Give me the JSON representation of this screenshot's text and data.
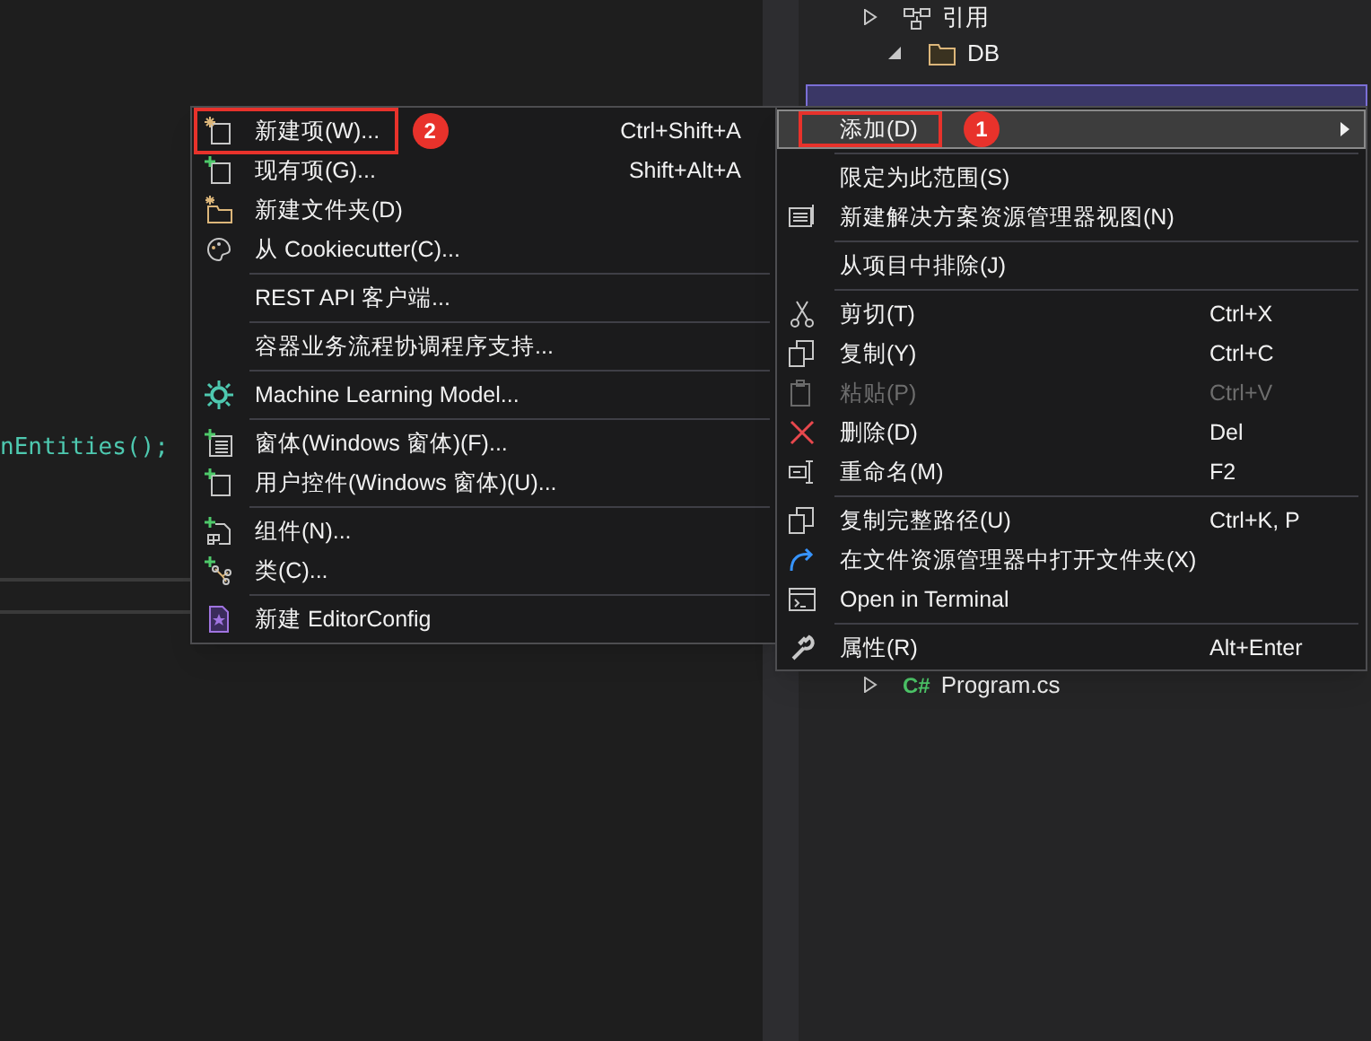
{
  "editor": {
    "code_line": "nEntities();"
  },
  "solution_explorer": {
    "items": [
      {
        "label": "引用",
        "kind": "references",
        "expanded": false
      },
      {
        "label": "DB",
        "kind": "folder",
        "expanded": true
      },
      {
        "label": "Program.cs",
        "kind": "csharp",
        "icon_text": "C#",
        "expanded": false
      }
    ]
  },
  "context_menu": {
    "items": [
      {
        "kind": "item",
        "label": "添加(D)",
        "disabled": false,
        "selected": true,
        "submenu": true,
        "annotation": "1"
      },
      {
        "kind": "separator"
      },
      {
        "kind": "item",
        "label": "限定为此范围(S)",
        "disabled": false,
        "selected": false,
        "submenu": false
      },
      {
        "kind": "item",
        "label": "新建解决方案资源管理器视图(N)",
        "disabled": false,
        "selected": false,
        "submenu": false
      },
      {
        "kind": "separator"
      },
      {
        "kind": "item",
        "label": "从项目中排除(J)",
        "disabled": false,
        "selected": false,
        "submenu": false
      },
      {
        "kind": "separator"
      },
      {
        "kind": "item",
        "label": "剪切(T)",
        "shortcut": "Ctrl+X",
        "disabled": false,
        "selected": false,
        "submenu": false
      },
      {
        "kind": "item",
        "label": "复制(Y)",
        "shortcut": "Ctrl+C",
        "disabled": false,
        "selected": false,
        "submenu": false
      },
      {
        "kind": "item",
        "label": "粘贴(P)",
        "shortcut": "Ctrl+V",
        "disabled": true,
        "selected": false,
        "submenu": false
      },
      {
        "kind": "item",
        "label": "删除(D)",
        "shortcut": "Del",
        "disabled": false,
        "selected": false,
        "submenu": false
      },
      {
        "kind": "item",
        "label": "重命名(M)",
        "shortcut": "F2",
        "disabled": false,
        "selected": false,
        "submenu": false
      },
      {
        "kind": "separator"
      },
      {
        "kind": "item",
        "label": "复制完整路径(U)",
        "shortcut": "Ctrl+K, P",
        "disabled": false,
        "selected": false,
        "submenu": false
      },
      {
        "kind": "item",
        "label": "在文件资源管理器中打开文件夹(X)",
        "disabled": false,
        "selected": false,
        "submenu": false
      },
      {
        "kind": "item",
        "label": "Open in Terminal",
        "disabled": false,
        "selected": false,
        "submenu": false
      },
      {
        "kind": "separator"
      },
      {
        "kind": "item",
        "label": "属性(R)",
        "shortcut": "Alt+Enter",
        "disabled": false,
        "selected": false,
        "submenu": false
      }
    ]
  },
  "submenu": {
    "items": [
      {
        "kind": "item",
        "label": "新建项(W)...",
        "shortcut": "Ctrl+Shift+A",
        "annotation": "2"
      },
      {
        "kind": "item",
        "label": "现有项(G)...",
        "shortcut": "Shift+Alt+A"
      },
      {
        "kind": "item",
        "label": "新建文件夹(D)"
      },
      {
        "kind": "item",
        "label": "从 Cookiecutter(C)..."
      },
      {
        "kind": "separator"
      },
      {
        "kind": "item",
        "label": "REST API 客户端..."
      },
      {
        "kind": "separator"
      },
      {
        "kind": "item",
        "label": "容器业务流程协调程序支持..."
      },
      {
        "kind": "separator"
      },
      {
        "kind": "item",
        "label": "Machine Learning Model..."
      },
      {
        "kind": "separator"
      },
      {
        "kind": "item",
        "label": "窗体(Windows 窗体)(F)..."
      },
      {
        "kind": "item",
        "label": "用户控件(Windows 窗体)(U)..."
      },
      {
        "kind": "separator"
      },
      {
        "kind": "item",
        "label": "组件(N)..."
      },
      {
        "kind": "item",
        "label": "类(C)..."
      },
      {
        "kind": "separator"
      },
      {
        "kind": "item",
        "label": "新建 EditorConfig"
      }
    ]
  }
}
